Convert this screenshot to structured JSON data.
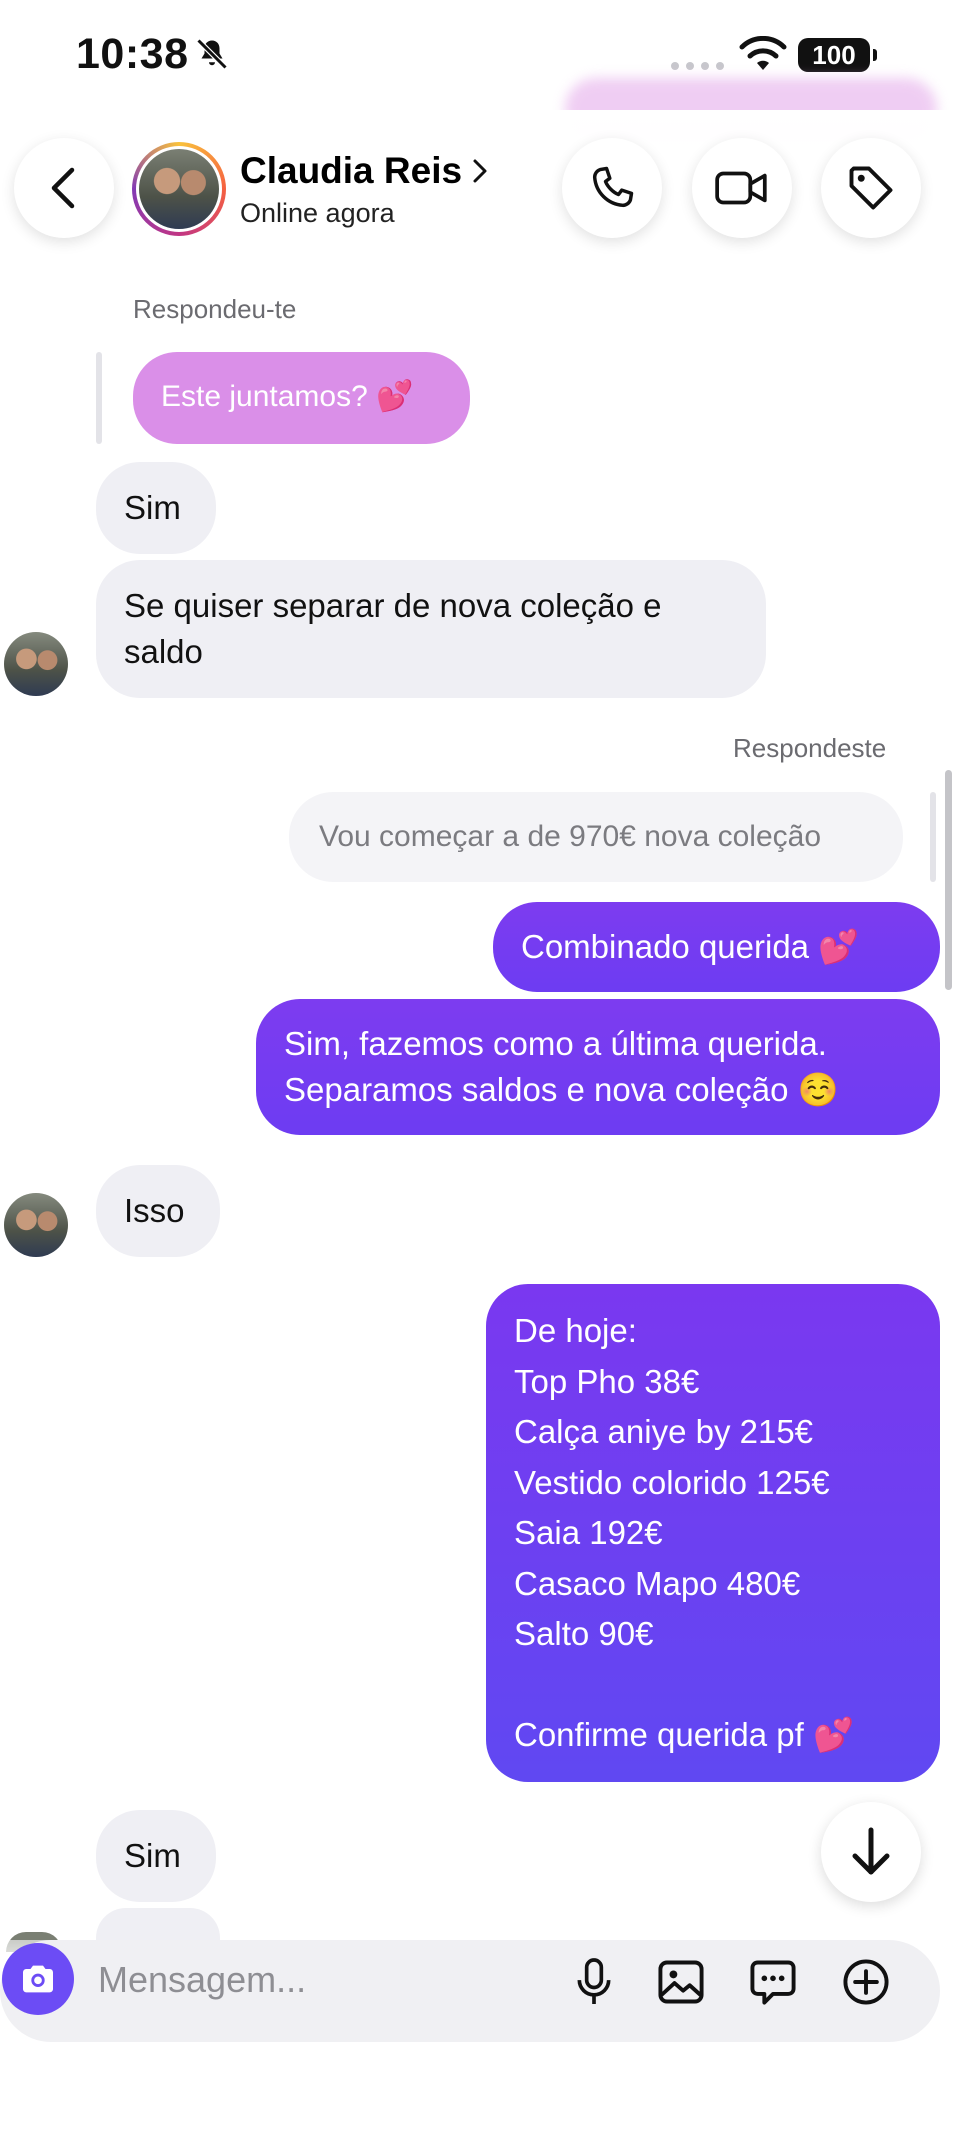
{
  "status_bar": {
    "time": "10:38",
    "battery": "100"
  },
  "header": {
    "name": "Claudia Reis",
    "status": "Online agora"
  },
  "messages": {
    "reply_received_label": "Respondeu-te",
    "quoted_received": "Este juntamos? 💕",
    "m1": "Sim",
    "m2": "Se quiser separar de nova coleção e saldo",
    "reply_sent_label": "Respondeste",
    "quoted_sent": "Vou começar a de 970€ nova coleção",
    "m3": "Combinado querida 💕",
    "m4_line1": "Sim, fazemos como a última querida.",
    "m4_line2": "Separamos saldos e nova coleção ☺️",
    "m5": "Isso",
    "m6_lines": [
      "De hoje:",
      "Top Pho 38€",
      "Calça aniye by 215€",
      "Vestido colorido 125€",
      "Saia 192€",
      "Casaco Mapo 480€",
      "Salto 90€",
      "",
      "Confirme querida pf 💕"
    ],
    "m7": "Sim"
  },
  "composer": {
    "placeholder": "Mensagem..."
  },
  "icons": {
    "back": "chevron-left-icon",
    "call": "phone-icon",
    "video": "video-camera-icon",
    "tag": "tag-icon",
    "camera": "camera-icon",
    "mic": "microphone-icon",
    "gallery": "image-icon",
    "sticker": "chat-bubble-icon",
    "add": "plus-circle-icon",
    "scroll_down": "arrow-down-icon"
  },
  "colors": {
    "sent_bubble": "#7b3cf1",
    "received_bubble": "#efeff4",
    "quoted_received_bubble": "#da8fe8",
    "camera_button": "#6c4cf5"
  }
}
